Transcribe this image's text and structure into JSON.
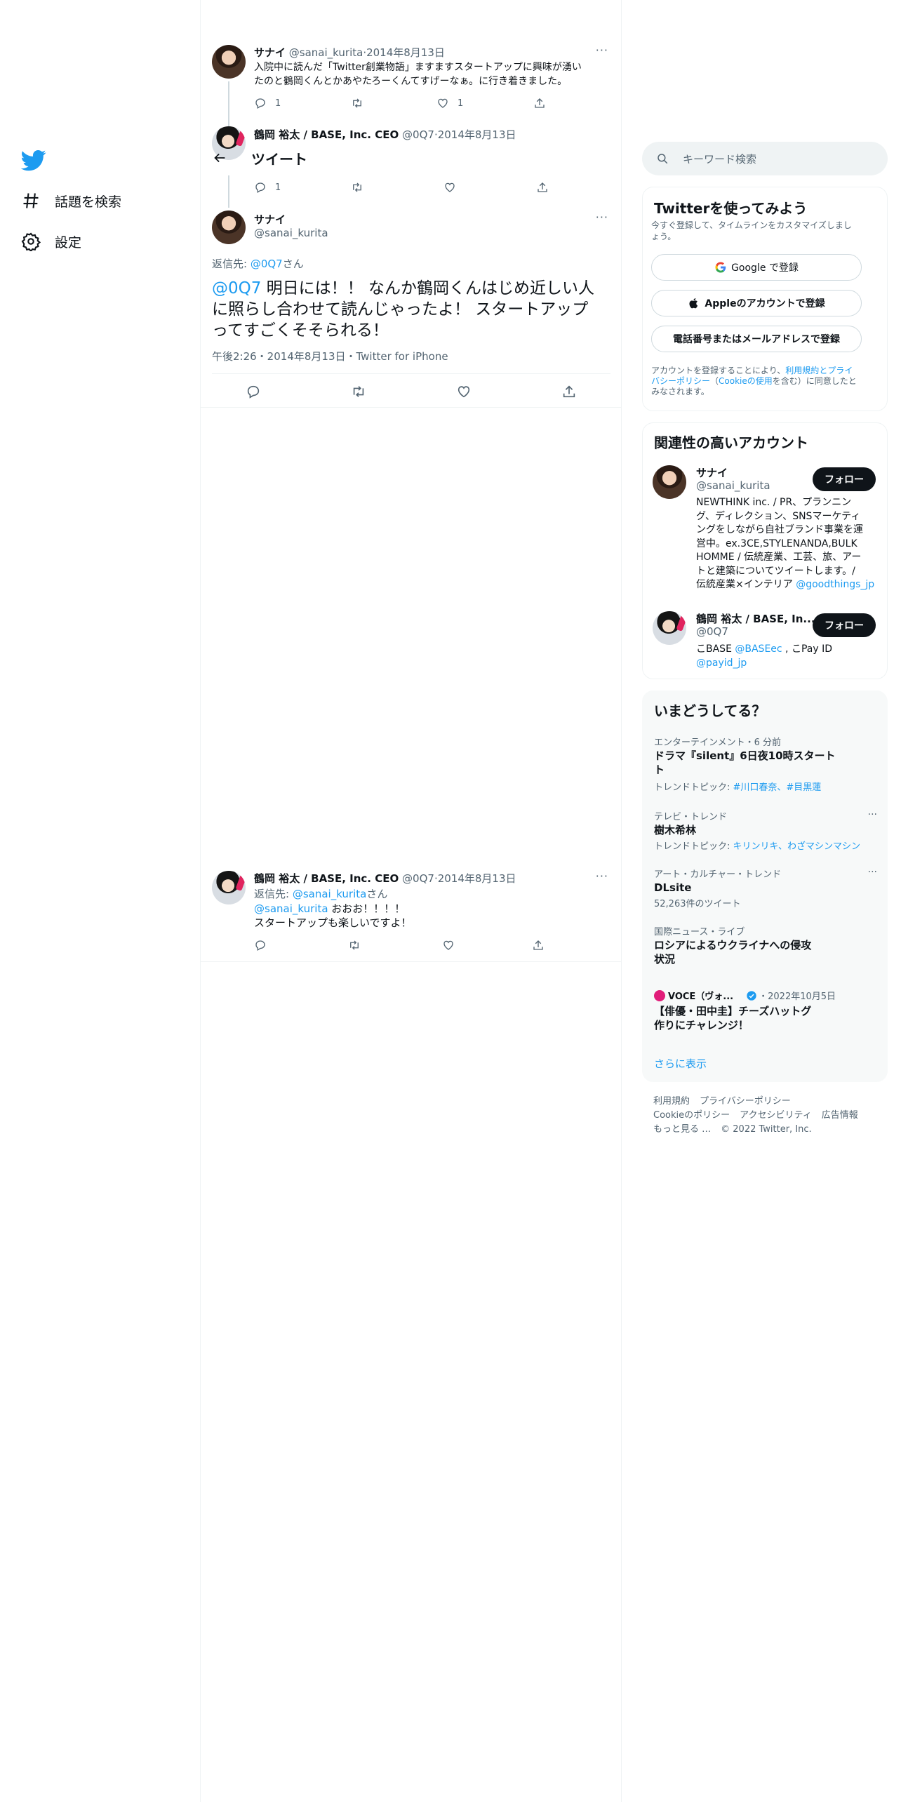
{
  "nav": {
    "explore": "話題を検索",
    "settings": "設定"
  },
  "header": {
    "title": "ツイート"
  },
  "tweet1": {
    "name": "サナイ",
    "handle": "@sanai_kurita",
    "date": "2014年8月13日",
    "line1": "入院中に読んだ「Twitter創業物語」ますますスタートアップに興味が湧い",
    "line2": "たのと鶴岡くんとかあやたろーくんてすげーなぁ。に行き着きました。",
    "reply_count": "1",
    "like_count": "1"
  },
  "tweet2": {
    "name": "鶴岡 裕太 / BASE, Inc. CEO",
    "handle": "@0Q7",
    "date": "2014年8月13日",
    "reply_count": "1"
  },
  "main_tweet": {
    "name": "サナイ",
    "handle": "@sanai_kurita",
    "reply_to_prefix": "返信先: ",
    "reply_to_handle": "@0Q7",
    "reply_to_suffix": "さん",
    "mention": "@0Q7",
    "text1": " 明日には！！ なんか鶴岡くんはじめ近しい人",
    "text2": "に照らし合わせて読んじゃったよ！ スタートアップ",
    "text3": "ってすごくそそられる！",
    "meta": "午後2:26・2014年8月13日・Twitter for iPhone"
  },
  "reply_tweet": {
    "name": "鶴岡 裕太 / BASE, Inc. CEO",
    "handle": "@0Q7",
    "date": "2014年8月13日",
    "reply_to_prefix": "返信先: ",
    "reply_to_handle": "@sanai_kurita",
    "reply_to_suffix": "さん",
    "mention": "@sanai_kurita",
    "text1": " おおお！！！！",
    "text2": "スタートアップも楽しいですよ！"
  },
  "search": {
    "placeholder": "キーワード検索"
  },
  "signup": {
    "title": "Twitterを使ってみよう",
    "subtitle1": "今すぐ登録して、タイムラインをカスタマイズしまし",
    "subtitle2": "ょう。",
    "google": "Google で登録",
    "apple": "Appleのアカウントで登録",
    "phone": "電話番号またはメールアドレスで登録",
    "legal1a": "アカウントを登録することにより、",
    "legal1b": "利用規約",
    "legal1c": "と",
    "legal1d": "プライ",
    "legal2a": "バシーポリシー",
    "legal2b": "（",
    "legal2c": "Cookieの使用",
    "legal2d": "を含む）に同意したと",
    "legal3": "みなされます。"
  },
  "relevant": {
    "title": "関連性の高いアカウント",
    "follow_label": "フォロー",
    "accounts": [
      {
        "name": "サナイ",
        "handle": "@sanai_kurita",
        "bio": [
          "NEWTHINK inc. / PR、プランニン",
          "グ、ディレクション、SNSマーケティ",
          "ングをしながら自社ブランド事業を運",
          "営中。ex.3CE,STYLENANDA,BULK",
          "HOMME / 伝統産業、工芸、旅、アー",
          "トと建築についてツイートします。/",
          "伝統産業×インテリア "
        ],
        "bio_link": "@goodthings_jp"
      },
      {
        "name": "鶴岡 裕太 / BASE, In...",
        "handle": "@0Q7",
        "bio_a": "こBASE ",
        "bio_link1": "@BASEec",
        "bio_b": " , こPay ID",
        "bio_link2": "@payid_jp"
      }
    ]
  },
  "trends": {
    "title": "いまどうしてる？",
    "items": [
      {
        "meta": "エンターテインメント・6 分前",
        "title1": "ドラマ『silent』6日夜10時スタート",
        "title2": "ト",
        "topics_label": "トレンドトピック: ",
        "topics": "#川口春奈、#目黒蓮"
      },
      {
        "meta": "テレビ・トレンド",
        "title1": "樹木希林",
        "topics_label": "トレンドトピック: ",
        "topics": "キリンリキ、わざマシンマシン"
      },
      {
        "meta": "アート・カルチャー・トレンド",
        "title1": "DLsite",
        "count": "52,263件のツイート"
      },
      {
        "meta": "国際ニュース・ライブ",
        "title1": "ロシアによるウクライナへの侵攻",
        "title2": "状況"
      },
      {
        "source": "VOCE（ヴォ...",
        "date": "・2022年10月5日",
        "title1": "【俳優・田中圭】チーズハットグ",
        "title2": "作りにチャレンジ！"
      }
    ],
    "show_more": "さらに表示"
  },
  "footer": {
    "line1": [
      "利用規約",
      "プライバシーポリシー"
    ],
    "line2": [
      "Cookieのポリシー",
      "アクセシビリティ",
      "広告情報"
    ],
    "line3": [
      "もっと見る …",
      "© 2022 Twitter, Inc."
    ]
  },
  "colors": {
    "accent": "#1d9bf0",
    "text": "#0f1419",
    "muted": "#536471",
    "border": "#eff3f4"
  }
}
